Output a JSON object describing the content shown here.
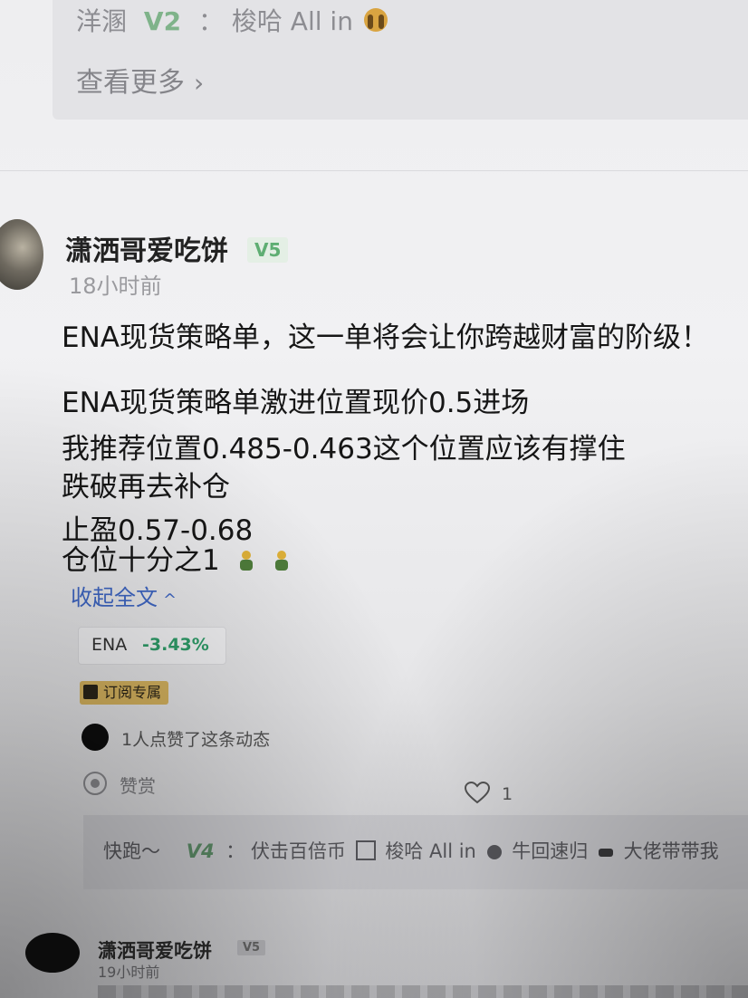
{
  "top_comment": {
    "user": "洋溷",
    "level": "V2",
    "colon": "：",
    "text": "梭哈 All in",
    "emoji_icon": "hands-over-face-emoji"
  },
  "see_more": {
    "label": "查看更多",
    "chevron": "›"
  },
  "post": {
    "username": "潇洒哥爱吃饼",
    "level": "V5",
    "timestamp": "18小时前",
    "lines": [
      "ENA现货策略单，这一单将会让你跨越财富的阶级！",
      "ENA现货策略单激进位置现价0.5进场",
      "我推荐位置0.485-0.463这个位置应该有撑住",
      "跌破再去补仓",
      "止盈0.57-0.68",
      "仓位十分之1"
    ],
    "emoji_icon": "praying-figure-emoji",
    "collapse_label": "收起全文",
    "collapse_caret": "^",
    "coin_tag": {
      "symbol": "ENA",
      "change": "-3.43%"
    },
    "subscription_badge": "订阅专属",
    "liked_text": "1人点赞了这条动态",
    "tip_label": "赞赏",
    "like_count": "1"
  },
  "comment2": {
    "user": "快跑～",
    "level": "V4",
    "colon": "：",
    "text_parts": [
      "伏击百倍币",
      "梭哈 All in",
      "牛回速归",
      "大佬带带我"
    ]
  },
  "next_post": {
    "username": "潇洒哥爱吃饼",
    "level": "V5",
    "timestamp": "19小时前"
  },
  "colors": {
    "accent_link": "#3f67c5",
    "level_green": "#5fae73",
    "negative_change": "#2f9e6a",
    "badge_gold": "#d7b45f"
  }
}
